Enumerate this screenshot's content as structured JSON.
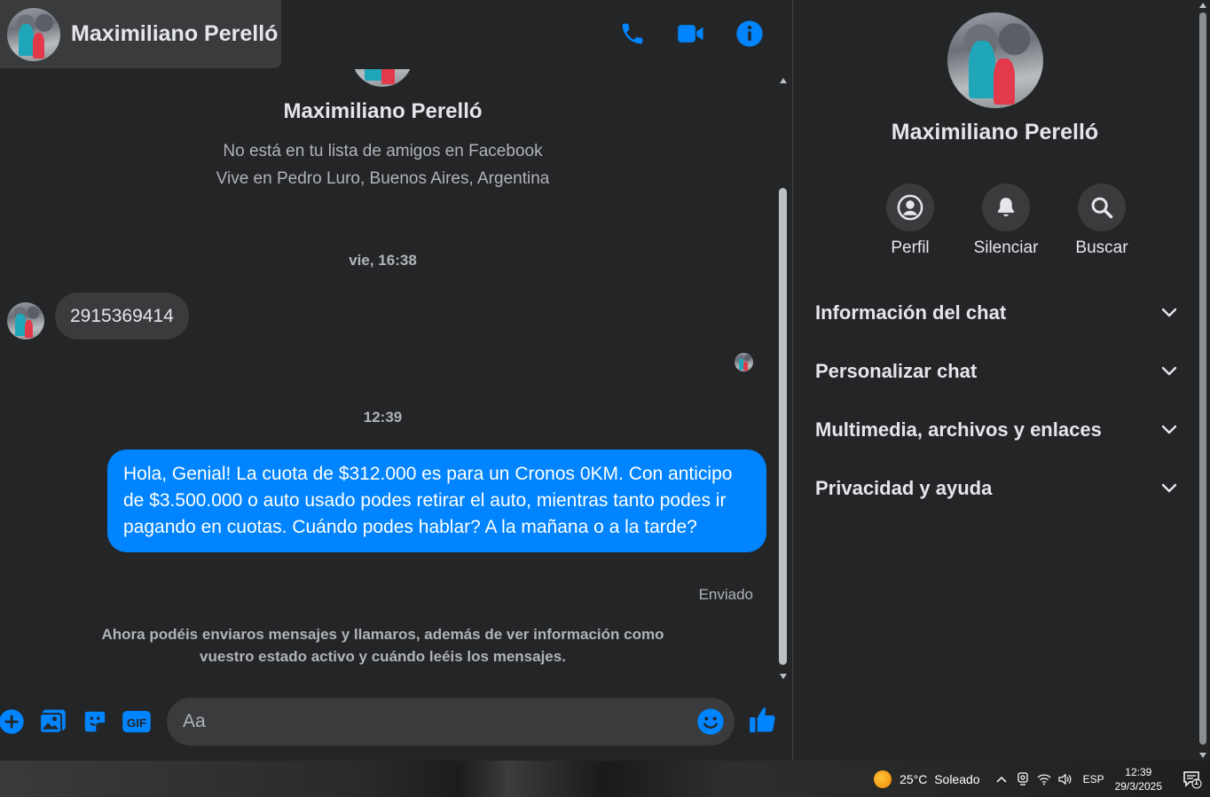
{
  "header": {
    "contact_name": "Maximiliano Perelló"
  },
  "conversation": {
    "profile_name": "Maximiliano Perelló",
    "profile_line1": "No está en tu lista de amigos en Facebook",
    "profile_line2": "Vive en Pedro Luro, Buenos Aires, Argentina",
    "timestamp1": "vie, 16:38",
    "incoming_message": "2915369414",
    "timestamp2": "12:39",
    "outgoing_message": "Hola, Genial! La cuota de $312.000 es para un Cronos 0KM. Con anticipo de $3.500.000 o auto usado podes retirar el auto, mientras tanto podes ir pagando en cuotas. Cuándo podes hablar? A la mañana o a la tarde?",
    "sent_status": "Enviado",
    "notice": "Ahora podéis enviaros mensajes y llamaros, además de ver información como vuestro estado activo y cuándo leéis los mensajes."
  },
  "composer": {
    "placeholder": "Aa"
  },
  "panel": {
    "name": "Maximiliano Perelló",
    "actions": [
      {
        "label": "Perfil",
        "icon": "profile-icon"
      },
      {
        "label": "Silenciar",
        "icon": "bell-icon"
      },
      {
        "label": "Buscar",
        "icon": "search-icon"
      }
    ],
    "sections": [
      {
        "label": "Información del chat"
      },
      {
        "label": "Personalizar chat"
      },
      {
        "label": "Multimedia, archivos y enlaces"
      },
      {
        "label": "Privacidad y ayuda"
      }
    ]
  },
  "taskbar": {
    "weather": "25°C  Soleado",
    "language": "ESP",
    "time": "12:39",
    "date": "29/3/2025",
    "notification_count": "1"
  },
  "colors": {
    "accent": "#0084ff",
    "background": "#242526",
    "surface": "#3a3b3c",
    "text_primary": "#e4e6eb",
    "text_secondary": "#b0b3b8"
  }
}
